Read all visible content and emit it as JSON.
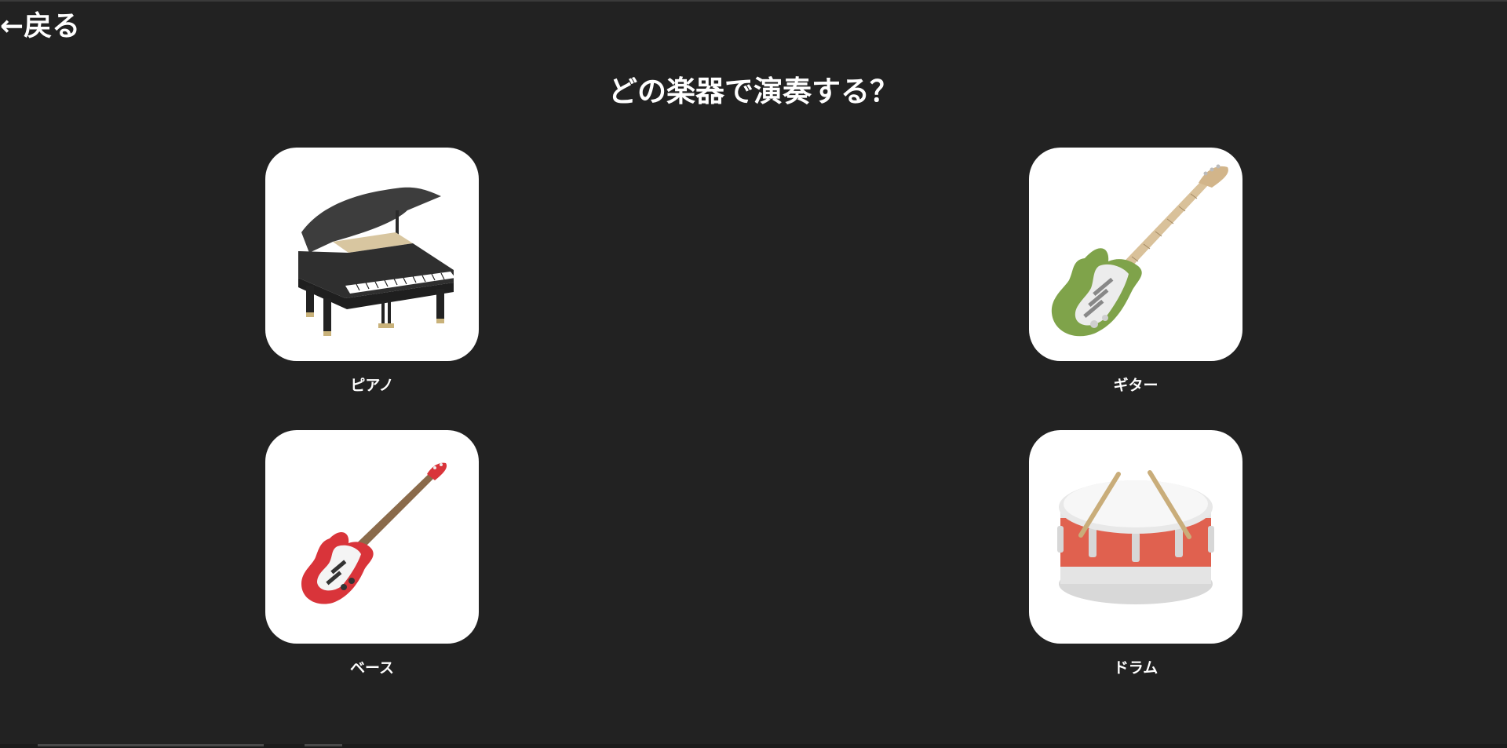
{
  "nav": {
    "back_label": "←戻る"
  },
  "page": {
    "title": "どの楽器で演奏する？"
  },
  "instruments": [
    {
      "label": "ピアノ",
      "icon": "grand-piano-icon"
    },
    {
      "label": "ギター",
      "icon": "electric-guitar-icon"
    },
    {
      "label": "ベース",
      "icon": "bass-guitar-icon"
    },
    {
      "label": "ドラム",
      "icon": "snare-drum-icon"
    }
  ],
  "colors": {
    "background": "#222222",
    "card": "#ffffff",
    "text": "#ffffff",
    "guitar_body": "#7fa34a",
    "bass_body": "#d9343a",
    "drum_shell": "#e0614f"
  }
}
